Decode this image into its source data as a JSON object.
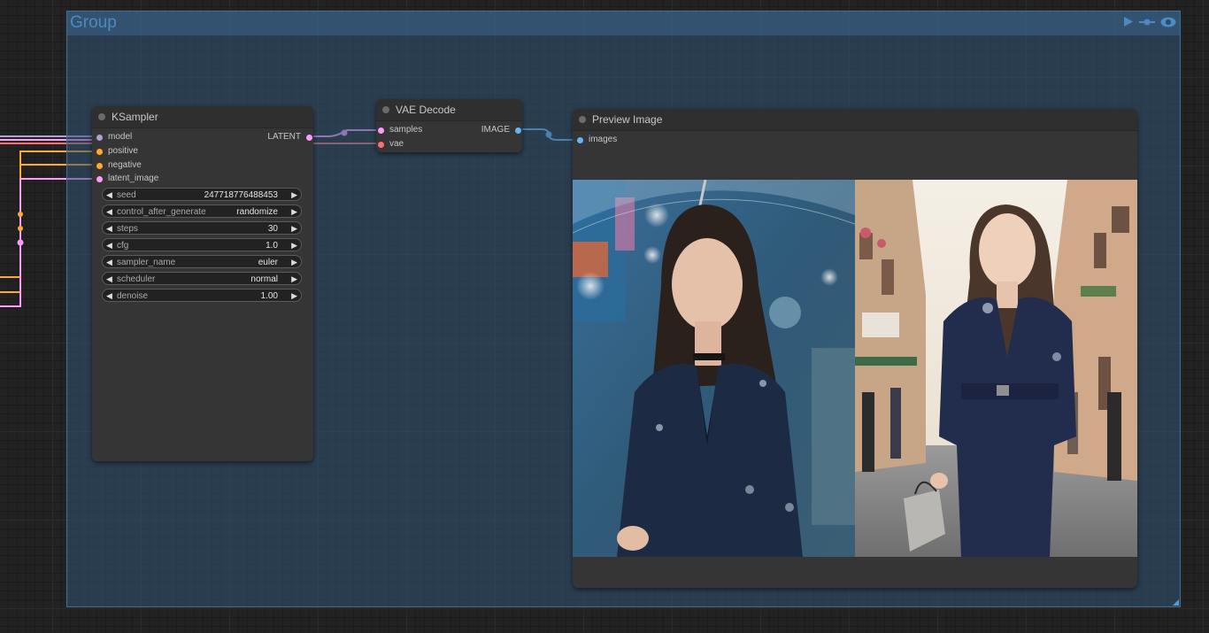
{
  "group": {
    "title": "Group",
    "accent": "#4d89c2"
  },
  "ksampler": {
    "title": "KSampler",
    "inputs": [
      "model",
      "positive",
      "negative",
      "latent_image"
    ],
    "output": "LATENT",
    "widgets": [
      {
        "label": "seed",
        "value": "247718776488453"
      },
      {
        "label": "control_after_generate",
        "value": "randomize"
      },
      {
        "label": "steps",
        "value": "30"
      },
      {
        "label": "cfg",
        "value": "1.0"
      },
      {
        "label": "sampler_name",
        "value": "euler"
      },
      {
        "label": "scheduler",
        "value": "normal"
      },
      {
        "label": "denoise",
        "value": "1.00"
      }
    ]
  },
  "vae_decode": {
    "title": "VAE Decode",
    "inputs": [
      "samples",
      "vae"
    ],
    "output": "IMAGE"
  },
  "preview": {
    "title": "Preview Image",
    "input": "images"
  },
  "colors": {
    "model": "#b39ddb",
    "conditioning": "#ffa931",
    "latent": "#ff9cf9",
    "vae": "#ff6e6e",
    "image": "#64b5f6"
  },
  "icons": [
    "play-icon",
    "bypass-icon",
    "eye-icon"
  ]
}
